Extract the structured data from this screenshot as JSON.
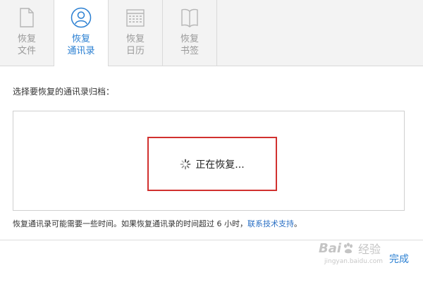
{
  "tabs": [
    {
      "line1": "恢复",
      "line2": "文件",
      "icon": "file-icon",
      "active": false
    },
    {
      "line1": "恢复",
      "line2": "通讯录",
      "icon": "contact-icon",
      "active": true
    },
    {
      "line1": "恢复",
      "line2": "日历",
      "icon": "calendar-icon",
      "active": false
    },
    {
      "line1": "恢复",
      "line2": "书签",
      "icon": "bookmark-icon",
      "active": false
    }
  ],
  "prompt": "选择要恢复的通讯录归档：",
  "status": {
    "text": "正在恢复..."
  },
  "note": {
    "text": "恢复通讯录可能需要一些时间。如果恢复通讯录的时间超过 6 小时，",
    "link": "联系技术支持",
    "end": "。"
  },
  "footer": {
    "done_label": "完成"
  },
  "watermark": {
    "logo_left": "Bai",
    "logo_right": "经验",
    "url": "jingyan.baidu.com"
  },
  "colors": {
    "accent": "#2a7fd2",
    "highlight_frame": "#d1312f",
    "inactive": "#9a9a9a"
  }
}
